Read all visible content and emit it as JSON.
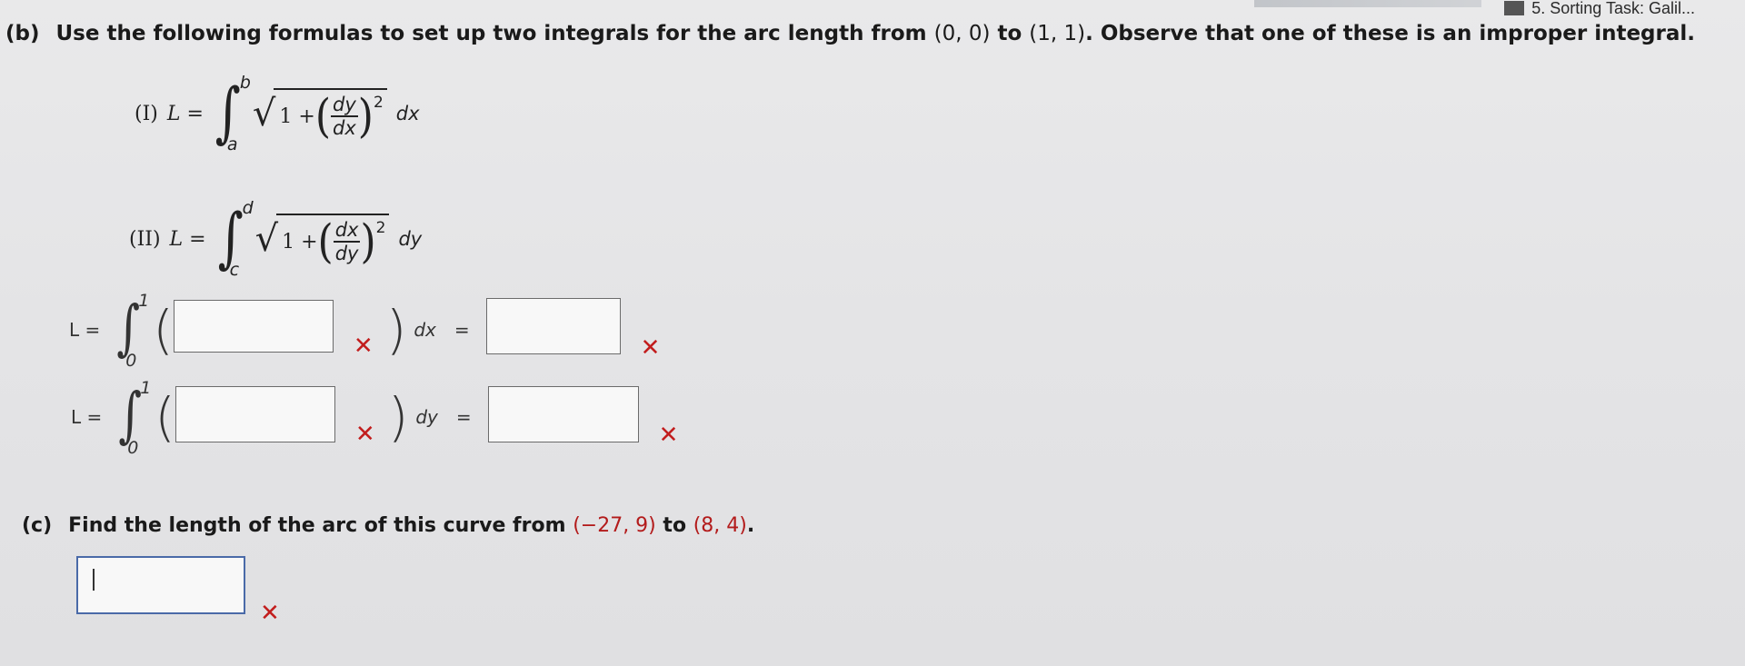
{
  "browser": {
    "tab_label": "5. Sorting Task: Galil..."
  },
  "part_b": {
    "label": "(b)",
    "instruction_pre": "Use the following formulas to set up two integrals for the arc length from ",
    "point_from": "(0, 0)",
    "to_word": " to ",
    "point_to": "(1, 1)",
    "instruction_post": ". Observe that one of these is an improper integral.",
    "formula_I": {
      "roman": "(I)",
      "lhs": "L =",
      "upper": "b",
      "lower": "a",
      "one_plus": "1 +",
      "frac_num": "dy",
      "frac_den": "dx",
      "power": "2",
      "differential": "dx"
    },
    "formula_II": {
      "roman": "(II)",
      "lhs": "L =",
      "upper": "d",
      "lower": "c",
      "one_plus": "1 +",
      "frac_num": "dx",
      "frac_den": "dy",
      "power": "2",
      "differential": "dy"
    },
    "integral_dx": {
      "lhs": "L =",
      "upper": "1",
      "lower": "0",
      "differential": "dx",
      "equals": "=",
      "integrand_value": "",
      "result_value": ""
    },
    "integral_dy": {
      "lhs": "L =",
      "upper": "1",
      "lower": "0",
      "differential": "dy",
      "equals": "=",
      "integrand_value": "",
      "result_value": ""
    }
  },
  "part_c": {
    "label": "(c)",
    "instruction_pre": "Find the length of the arc of this curve from ",
    "point_from": "(−27, 9)",
    "to_word": " to ",
    "point_to": "(8, 4)",
    "instruction_post": ".",
    "answer_value": ""
  },
  "marks": {
    "wrong": "✕"
  },
  "colors": {
    "wrong": "#c21d1d",
    "highlight_point": "#b31b1b",
    "background": "#e6e6e8"
  }
}
